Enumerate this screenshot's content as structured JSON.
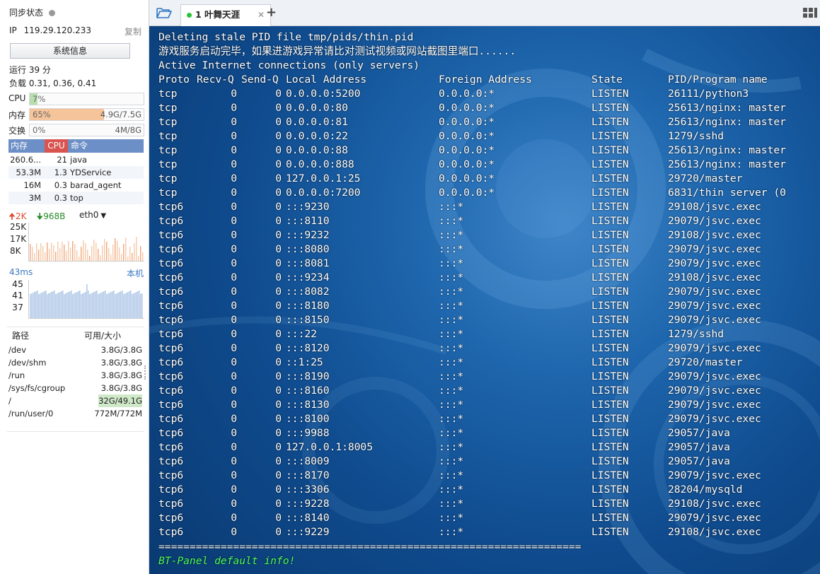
{
  "sidebar": {
    "sync_label": "同步状态",
    "ip_label": "IP",
    "ip_value": "119.29.120.233",
    "copy_label": "复制",
    "sysinfo_button": "系统信息",
    "uptime": "运行 39 分",
    "load": "负载 0.31, 0.36, 0.41",
    "cpu": {
      "label": "CPU",
      "value": "7%",
      "fraction": 0.07
    },
    "mem": {
      "label": "内存",
      "value": "65%",
      "total": "4.9G/7.5G",
      "fraction": 0.65
    },
    "swap": {
      "label": "交换",
      "value": "0%",
      "total": "4M/8G",
      "fraction": 0.0
    },
    "proc_headers": {
      "mem": "内存",
      "cpu": "CPU",
      "cmd": "命令"
    },
    "processes": [
      {
        "mem": "260.6...",
        "cpu": "21",
        "cmd": "java"
      },
      {
        "mem": "53.3M",
        "cpu": "1.3",
        "cmd": "YDService"
      },
      {
        "mem": "16M",
        "cpu": "0.3",
        "cmd": "barad_agent"
      },
      {
        "mem": "3M",
        "cpu": "0.3",
        "cmd": "top"
      }
    ],
    "net": {
      "up": "2K",
      "down": "968B",
      "iface": "eth0",
      "ticks": [
        "25K",
        "17K",
        "8K"
      ]
    },
    "ping": {
      "latency": "43ms",
      "host": "本机",
      "ticks": [
        "45",
        "41",
        "37"
      ]
    },
    "disk_headers": {
      "path": "路径",
      "size": "可用/大小"
    },
    "disks": [
      {
        "path": "/dev",
        "size": "3.8G/3.8G"
      },
      {
        "path": "/dev/shm",
        "size": "3.8G/3.8G"
      },
      {
        "path": "/run",
        "size": "3.8G/3.8G"
      },
      {
        "path": "/sys/fs/cgroup",
        "size": "3.8G/3.8G"
      },
      {
        "path": "/",
        "size": "32G/49.1G"
      },
      {
        "path": "/run/user/0",
        "size": "772M/772M"
      }
    ]
  },
  "tabs": [
    {
      "label": "1 叶舞天涯"
    }
  ],
  "terminal": {
    "line1": "Deleting stale PID file tmp/pids/thin.pid",
    "line2": "游戏服务启动完毕，如果进游戏异常请比对测试视频或网站截图里端口......",
    "line3": "Active Internet connections (only servers)",
    "headers": {
      "proto": "Proto",
      "recvq": "Recv-Q",
      "sendq": "Send-Q",
      "local": "Local Address",
      "foreign": "Foreign Address",
      "state": "State",
      "pid": "PID/Program name"
    },
    "rows": [
      [
        "tcp",
        "0",
        "0",
        "0.0.0.0:5200",
        "0.0.0.0:*",
        "LISTEN",
        "26111/python3"
      ],
      [
        "tcp",
        "0",
        "0",
        "0.0.0.0:80",
        "0.0.0.0:*",
        "LISTEN",
        "25613/nginx: master"
      ],
      [
        "tcp",
        "0",
        "0",
        "0.0.0.0:81",
        "0.0.0.0:*",
        "LISTEN",
        "25613/nginx: master"
      ],
      [
        "tcp",
        "0",
        "0",
        "0.0.0.0:22",
        "0.0.0.0:*",
        "LISTEN",
        "1279/sshd"
      ],
      [
        "tcp",
        "0",
        "0",
        "0.0.0.0:88",
        "0.0.0.0:*",
        "LISTEN",
        "25613/nginx: master"
      ],
      [
        "tcp",
        "0",
        "0",
        "0.0.0.0:888",
        "0.0.0.0:*",
        "LISTEN",
        "25613/nginx: master"
      ],
      [
        "tcp",
        "0",
        "0",
        "127.0.0.1:25",
        "0.0.0.0:*",
        "LISTEN",
        "29720/master"
      ],
      [
        "tcp",
        "0",
        "0",
        "0.0.0.0:7200",
        "0.0.0.0:*",
        "LISTEN",
        "6831/thin server (0"
      ],
      [
        "tcp6",
        "0",
        "0",
        ":::9230",
        ":::*",
        "LISTEN",
        "29108/jsvc.exec"
      ],
      [
        "tcp6",
        "0",
        "0",
        ":::8110",
        ":::*",
        "LISTEN",
        "29079/jsvc.exec"
      ],
      [
        "tcp6",
        "0",
        "0",
        ":::9232",
        ":::*",
        "LISTEN",
        "29108/jsvc.exec"
      ],
      [
        "tcp6",
        "0",
        "0",
        ":::8080",
        ":::*",
        "LISTEN",
        "29079/jsvc.exec"
      ],
      [
        "tcp6",
        "0",
        "0",
        ":::8081",
        ":::*",
        "LISTEN",
        "29079/jsvc.exec"
      ],
      [
        "tcp6",
        "0",
        "0",
        ":::9234",
        ":::*",
        "LISTEN",
        "29108/jsvc.exec"
      ],
      [
        "tcp6",
        "0",
        "0",
        ":::8082",
        ":::*",
        "LISTEN",
        "29079/jsvc.exec"
      ],
      [
        "tcp6",
        "0",
        "0",
        ":::8180",
        ":::*",
        "LISTEN",
        "29079/jsvc.exec"
      ],
      [
        "tcp6",
        "0",
        "0",
        ":::8150",
        ":::*",
        "LISTEN",
        "29079/jsvc.exec"
      ],
      [
        "tcp6",
        "0",
        "0",
        ":::22",
        ":::*",
        "LISTEN",
        "1279/sshd"
      ],
      [
        "tcp6",
        "0",
        "0",
        ":::8120",
        ":::*",
        "LISTEN",
        "29079/jsvc.exec"
      ],
      [
        "tcp6",
        "0",
        "0",
        "::1:25",
        ":::*",
        "LISTEN",
        "29720/master"
      ],
      [
        "tcp6",
        "0",
        "0",
        ":::8190",
        ":::*",
        "LISTEN",
        "29079/jsvc.exec"
      ],
      [
        "tcp6",
        "0",
        "0",
        ":::8160",
        ":::*",
        "LISTEN",
        "29079/jsvc.exec"
      ],
      [
        "tcp6",
        "0",
        "0",
        ":::8130",
        ":::*",
        "LISTEN",
        "29079/jsvc.exec"
      ],
      [
        "tcp6",
        "0",
        "0",
        ":::8100",
        ":::*",
        "LISTEN",
        "29079/jsvc.exec"
      ],
      [
        "tcp6",
        "0",
        "0",
        ":::9988",
        ":::*",
        "LISTEN",
        "29057/java"
      ],
      [
        "tcp6",
        "0",
        "0",
        "127.0.0.1:8005",
        ":::*",
        "LISTEN",
        "29057/java"
      ],
      [
        "tcp6",
        "0",
        "0",
        ":::8009",
        ":::*",
        "LISTEN",
        "29057/java"
      ],
      [
        "tcp6",
        "0",
        "0",
        ":::8170",
        ":::*",
        "LISTEN",
        "29079/jsvc.exec"
      ],
      [
        "tcp6",
        "0",
        "0",
        ":::3306",
        ":::*",
        "LISTEN",
        "28204/mysqld"
      ],
      [
        "tcp6",
        "0",
        "0",
        ":::9228",
        ":::*",
        "LISTEN",
        "29108/jsvc.exec"
      ],
      [
        "tcp6",
        "0",
        "0",
        ":::8140",
        ":::*",
        "LISTEN",
        "29079/jsvc.exec"
      ],
      [
        "tcp6",
        "0",
        "0",
        ":::9229",
        ":::*",
        "LISTEN",
        "29108/jsvc.exec"
      ]
    ],
    "separator": "====================================================================",
    "footer": "BT-Panel default info!"
  },
  "colors": {
    "accent": "#6b8fc6",
    "cpu_header": "#d9534f",
    "mem_fill": "#f5c49a",
    "terminal_green": "#4dff5a"
  },
  "icons": {
    "folder": "folder-open-icon",
    "add": "plus-icon",
    "layout": "grid-layout-icon"
  }
}
